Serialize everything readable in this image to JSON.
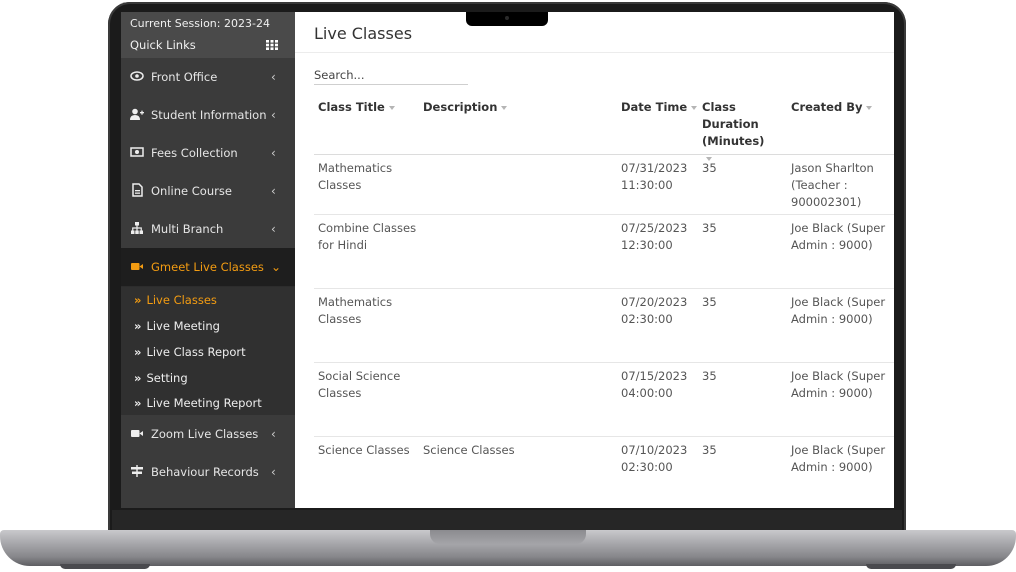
{
  "session": {
    "label": "Current Session: 2023-24",
    "quick_links": "Quick Links"
  },
  "sidebar": {
    "items": [
      {
        "label": "Front Office",
        "icon": "front-office-icon"
      },
      {
        "label": "Student Information",
        "icon": "user-add-icon"
      },
      {
        "label": "Fees Collection",
        "icon": "money-icon"
      },
      {
        "label": "Online Course",
        "icon": "file-icon"
      },
      {
        "label": "Multi Branch",
        "icon": "sitemap-icon"
      },
      {
        "label": "Gmeet Live Classes",
        "icon": "video-icon"
      },
      {
        "label": "Zoom Live Classes",
        "icon": "video-icon"
      },
      {
        "label": "Behaviour Records",
        "icon": "signpost-icon"
      }
    ],
    "submenu": [
      {
        "label": "Live Classes"
      },
      {
        "label": "Live Meeting"
      },
      {
        "label": "Live Class Report"
      },
      {
        "label": "Setting"
      },
      {
        "label": "Live Meeting Report"
      }
    ],
    "active_color": "#f39c12"
  },
  "main": {
    "title": "Live Classes",
    "search_placeholder": "Search...",
    "columns": [
      "Class Title",
      "Description",
      "Date Time",
      "Class Duration (Minutes)",
      "Created By"
    ],
    "rows": [
      {
        "title": "Mathematics Classes",
        "description": "",
        "datetime": "07/31/2023 11:30:00",
        "duration": "35",
        "created_by": "Jason Sharlton (Teacher : 900002301)"
      },
      {
        "title": "Combine Classes for Hindi",
        "description": "",
        "datetime": "07/25/2023 12:30:00",
        "duration": "35",
        "created_by": "Joe Black (Super Admin : 9000)"
      },
      {
        "title": "Mathematics Classes",
        "description": "",
        "datetime": "07/20/2023 02:30:00",
        "duration": "35",
        "created_by": "Joe Black (Super Admin : 9000)"
      },
      {
        "title": "Social Science Classes",
        "description": "",
        "datetime": "07/15/2023 04:00:00",
        "duration": "35",
        "created_by": "Joe Black (Super Admin : 9000)"
      },
      {
        "title": "Science Classes",
        "description": "Science Classes",
        "datetime": "07/10/2023 02:30:00",
        "duration": "35",
        "created_by": "Joe Black (Super Admin : 9000)"
      }
    ]
  }
}
